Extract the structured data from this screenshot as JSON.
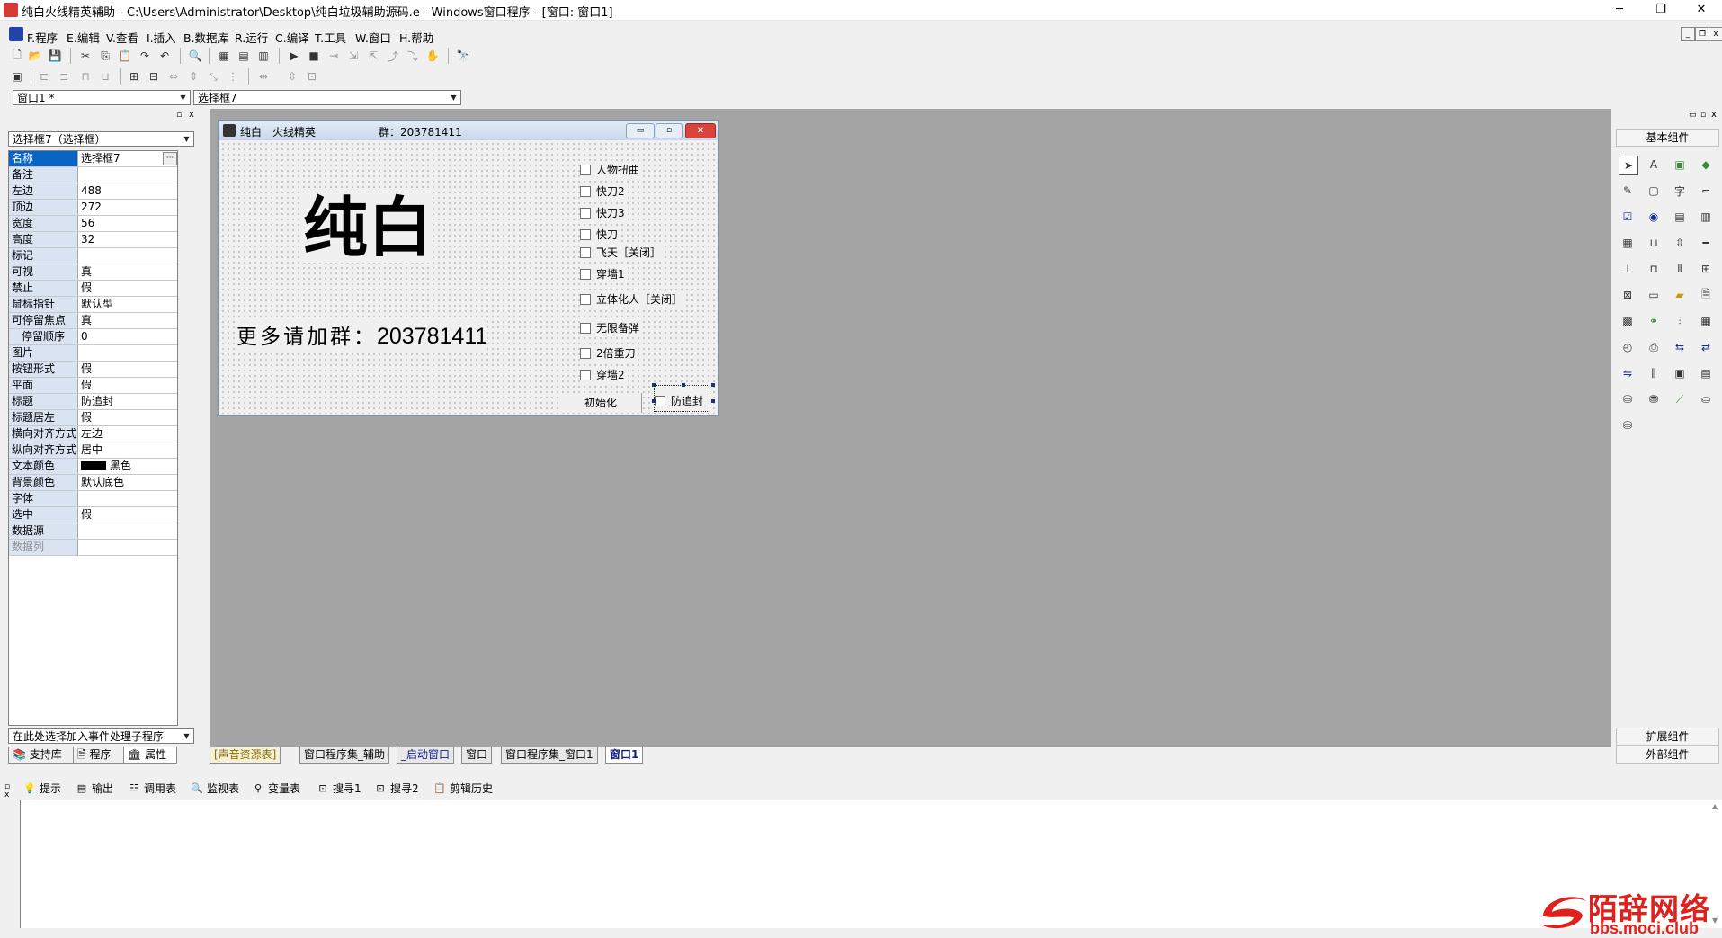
{
  "window": {
    "title": "纯白火线精英辅助 - C:\\Users\\Administrator\\Desktop\\纯白垃圾辅助源码.e - Windows窗口程序 - [窗口: 窗口1]",
    "controls": [
      "─",
      "❐",
      "✕"
    ]
  },
  "menu": {
    "items": [
      "F.程序",
      "E.编辑",
      "V.查看",
      "I.插入",
      "B.数据库",
      "R.运行",
      "C.编译",
      "T.工具",
      "W.窗口",
      "H.帮助"
    ],
    "right_controls": [
      "_",
      "❐",
      "x"
    ]
  },
  "combos": {
    "window_select": "窗口1 *",
    "component_select": "选择框7"
  },
  "left_panel": {
    "header_controls": [
      "▫",
      "x"
    ],
    "object_combo": "选择框7（选择框）",
    "properties": [
      {
        "name": "名称",
        "value": "选择框7",
        "selected": true,
        "ellipsis": "···"
      },
      {
        "name": "备注",
        "value": ""
      },
      {
        "name": "左边",
        "value": "488"
      },
      {
        "name": "顶边",
        "value": "272"
      },
      {
        "name": "宽度",
        "value": "56"
      },
      {
        "name": "高度",
        "value": "32"
      },
      {
        "name": "标记",
        "value": ""
      },
      {
        "name": "可视",
        "value": "真"
      },
      {
        "name": "禁止",
        "value": "假"
      },
      {
        "name": "鼠标指针",
        "value": "默认型"
      },
      {
        "name": "可停留焦点",
        "value": "真"
      },
      {
        "name": "停留顺序",
        "value": "0",
        "indent": true
      },
      {
        "name": "图片",
        "value": ""
      },
      {
        "name": "按钮形式",
        "value": "假"
      },
      {
        "name": "平面",
        "value": "假"
      },
      {
        "name": "标题",
        "value": "防追封"
      },
      {
        "name": "标题居左",
        "value": "假"
      },
      {
        "name": "横向对齐方式",
        "value": "左边"
      },
      {
        "name": "纵向对齐方式",
        "value": "居中"
      },
      {
        "name": "文本颜色",
        "value": "黑色",
        "swatch": "#000000"
      },
      {
        "name": "背景颜色",
        "value": "默认底色"
      },
      {
        "name": "字体",
        "value": ""
      },
      {
        "name": "选中",
        "value": "假"
      },
      {
        "name": "数据源",
        "value": ""
      },
      {
        "name": "数据列",
        "value": "",
        "dim": true
      }
    ],
    "event_combo": "在此处选择加入事件处理子程序",
    "tabs": [
      "支持库",
      "程序",
      "属性"
    ]
  },
  "designer": {
    "title": "纯白　火线精英",
    "group_label": "群：203781411",
    "title_controls": [
      "▭",
      "▫",
      "✕"
    ],
    "big_title": "纯白",
    "sub_text": "更多请加群：",
    "sub_number": "203781411",
    "checkboxes": [
      "人物扭曲",
      "快刀2",
      "快刀3",
      "快刀",
      "飞天［关闭］",
      "穿墙1",
      "立体化人［关闭］",
      "无限备弹",
      "2倍重刀",
      "穿墙2"
    ],
    "init_button": "初始化",
    "selected_checkbox": "防追封"
  },
  "bottom_tabs": [
    "[声音资源表]",
    "窗口程序集_辅助",
    "_启动窗口",
    "窗口",
    "窗口程序集_窗口1",
    "窗口1"
  ],
  "output_tabs": [
    "提示",
    "输出",
    "调用表",
    "监视表",
    "变量表",
    "搜寻1",
    "搜寻2",
    "剪辑历史"
  ],
  "right_panel": {
    "header_controls": [
      "▭",
      "▫",
      "x"
    ],
    "basic": "基本组件",
    "extended": "扩展组件",
    "external": "外部组件"
  },
  "watermark": {
    "brand": "陌辞网络",
    "url": "bbs.moci.club"
  },
  "colors": {
    "selection": "#0a64c6",
    "workspace": "#a4a4a4",
    "watermark": "#e0201c"
  }
}
